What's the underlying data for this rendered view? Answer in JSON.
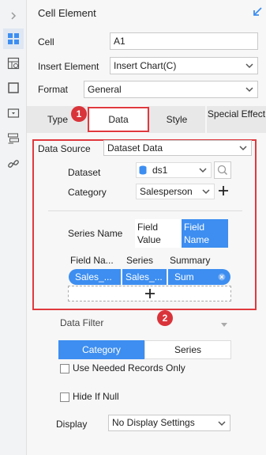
{
  "panel": {
    "title": "Cell Element"
  },
  "form": {
    "cell_label": "Cell",
    "cell_value": "A1",
    "insert_label": "Insert Element",
    "insert_value": "Insert Chart(C)",
    "format_label": "Format",
    "format_value": "General"
  },
  "tabs": [
    {
      "label": "Type"
    },
    {
      "label": "Data"
    },
    {
      "label": "Style"
    },
    {
      "label": "Special Effect"
    }
  ],
  "callouts": {
    "one": "1",
    "two": "2"
  },
  "data": {
    "source_label": "Data Source",
    "source_value": "Dataset Data",
    "dataset_label": "Dataset",
    "dataset_value": "ds1",
    "category_label": "Category",
    "category_value": "Salesperson",
    "series_name_label": "Series Name",
    "series_opt_value": "Field Value",
    "series_opt_name": "Field Name",
    "columns": [
      "Field Na...",
      "Series",
      "Summary"
    ],
    "row": [
      "Sales_...",
      "Sales_...",
      "Sum"
    ],
    "add_symbol": "+"
  },
  "filter": {
    "label": "Data Filter",
    "tab_category": "Category",
    "tab_series": "Series",
    "use_needed": "Use Needed Records Only",
    "hide_null": "Hide If Null",
    "display_label": "Display",
    "display_value": "No Display Settings"
  },
  "colors": {
    "accent": "#3d8ef0",
    "highlight": "#e0393e"
  }
}
